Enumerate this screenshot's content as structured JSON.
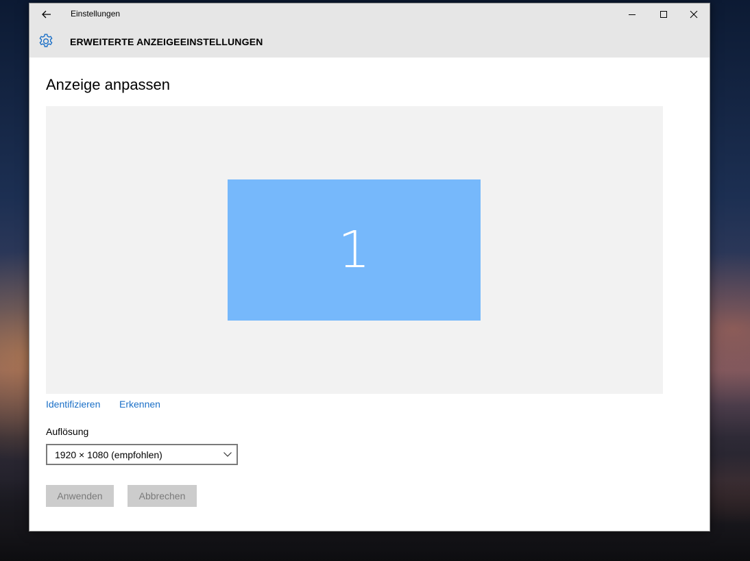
{
  "window": {
    "title": "Einstellungen"
  },
  "header": {
    "title": "ERWEITERTE ANZEIGEEINSTELLUNGEN",
    "icon": "gear-icon",
    "accent_color": "#1a6fc7"
  },
  "main": {
    "heading": "Anzeige anpassen",
    "monitor": {
      "number": "1",
      "color": "#76b8fb"
    },
    "links": {
      "identify": "Identifizieren",
      "detect": "Erkennen"
    },
    "resolution": {
      "label": "Auflösung",
      "selected": "1920 × 1080 (empfohlen)"
    },
    "buttons": {
      "apply": "Anwenden",
      "cancel": "Abbrechen"
    }
  }
}
